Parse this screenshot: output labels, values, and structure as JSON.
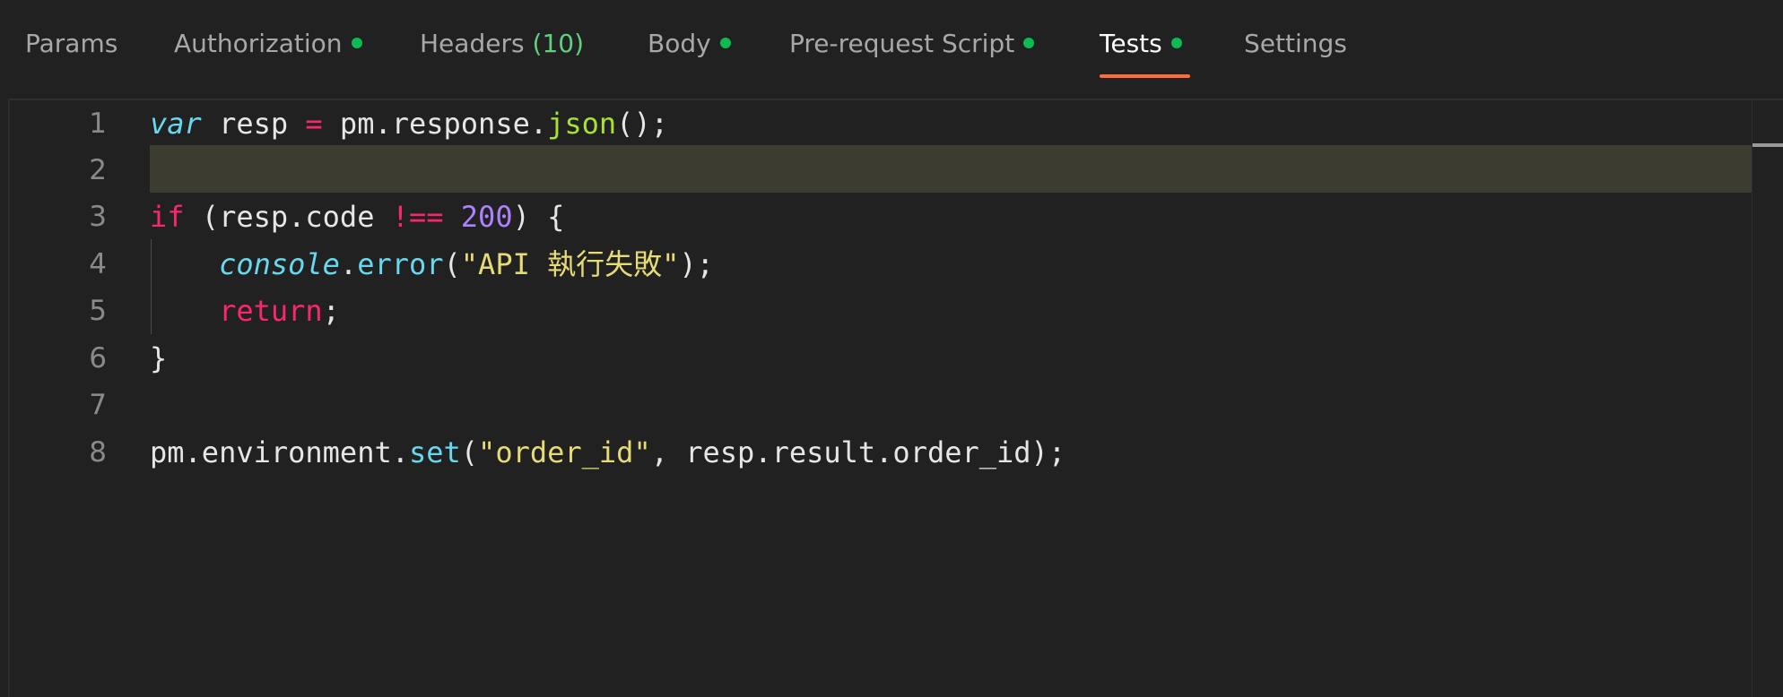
{
  "tabs": [
    {
      "label": "Params",
      "dot": false
    },
    {
      "label": "Authorization",
      "dot": true
    },
    {
      "label": "Headers",
      "count": "(10)",
      "dot": false
    },
    {
      "label": "Body",
      "dot": true
    },
    {
      "label": "Pre-request Script",
      "dot": true
    },
    {
      "label": "Tests",
      "dot": true,
      "active": true
    },
    {
      "label": "Settings",
      "dot": false
    }
  ],
  "colors": {
    "accent_underline": "#ff6c37",
    "indicator_dot": "#0cbb52",
    "count_text": "#5fcf80",
    "active_line": "#3c3c30"
  },
  "editor": {
    "language": "javascript",
    "active_line": 2,
    "line_numbers": [
      "1",
      "2",
      "3",
      "4",
      "5",
      "6",
      "7",
      "8"
    ],
    "lines": [
      [
        {
          "t": "var",
          "c": "kw-var"
        },
        {
          "t": " resp ",
          "c": "plain"
        },
        {
          "t": "=",
          "c": "op"
        },
        {
          "t": " pm.response.",
          "c": "plain"
        },
        {
          "t": "json",
          "c": "fn"
        },
        {
          "t": "();",
          "c": "plain"
        }
      ],
      [],
      [
        {
          "t": "if",
          "c": "kw"
        },
        {
          "t": " (resp.code ",
          "c": "plain"
        },
        {
          "t": "!==",
          "c": "op"
        },
        {
          "t": " ",
          "c": "plain"
        },
        {
          "t": "200",
          "c": "num"
        },
        {
          "t": ") {",
          "c": "plain"
        }
      ],
      [
        {
          "t": "    ",
          "c": "plain"
        },
        {
          "t": "console",
          "c": "global"
        },
        {
          "t": ".",
          "c": "plain"
        },
        {
          "t": "error",
          "c": "method"
        },
        {
          "t": "(",
          "c": "plain"
        },
        {
          "t": "\"API 執行失敗\"",
          "c": "str"
        },
        {
          "t": ");",
          "c": "plain"
        }
      ],
      [
        {
          "t": "    ",
          "c": "plain"
        },
        {
          "t": "return",
          "c": "kw"
        },
        {
          "t": ";",
          "c": "plain"
        }
      ],
      [
        {
          "t": "}",
          "c": "plain"
        }
      ],
      [],
      [
        {
          "t": "pm.environment.",
          "c": "plain"
        },
        {
          "t": "set",
          "c": "method"
        },
        {
          "t": "(",
          "c": "plain"
        },
        {
          "t": "\"order_id\"",
          "c": "str"
        },
        {
          "t": ", resp.result.order_id);",
          "c": "plain"
        }
      ]
    ]
  }
}
